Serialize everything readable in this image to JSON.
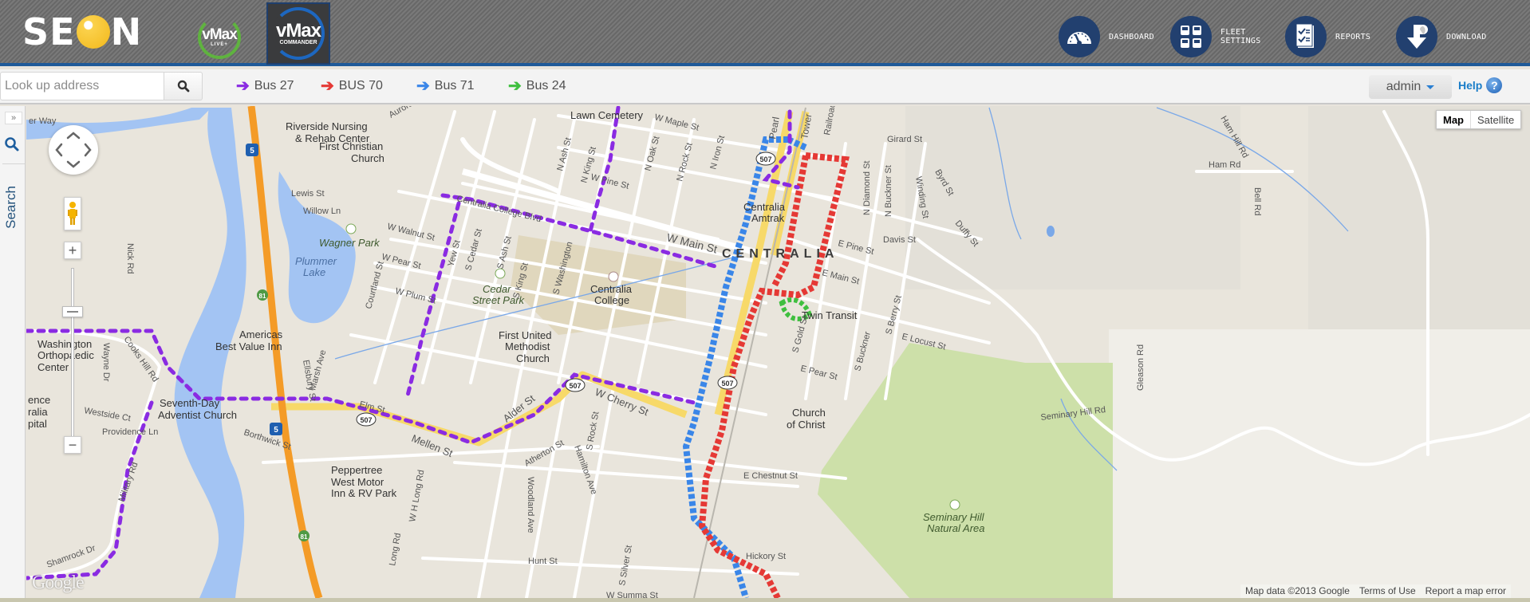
{
  "header": {
    "brand": "SEON",
    "apps": [
      {
        "name": "vMax",
        "sub": "LIVE+",
        "active": false
      },
      {
        "name": "vMax",
        "sub": "COMMANDER",
        "active": true
      }
    ],
    "nav": [
      {
        "label": "DASHBOARD",
        "icon": "speedometer-icon"
      },
      {
        "label": "FLEET\nSETTINGS",
        "icon": "fleet-buses-icon"
      },
      {
        "label": "REPORTS",
        "icon": "checklist-report-icon"
      },
      {
        "label": "DOWNLOAD",
        "icon": "download-arrow-icon"
      }
    ]
  },
  "toolbar": {
    "search_placeholder": "Look up address",
    "search_value": "",
    "buses": [
      {
        "label": "Bus 27",
        "color": "#8a2be2"
      },
      {
        "label": "BUS 70",
        "color": "#e53935"
      },
      {
        "label": "Bus 71",
        "color": "#3a86e8"
      },
      {
        "label": "Bus 24",
        "color": "#3fbf3f"
      }
    ],
    "user": "admin",
    "help": "Help",
    "help_icon": "?"
  },
  "sidepanel": {
    "expand": "»",
    "search_label": "Search"
  },
  "map": {
    "type_buttons": [
      {
        "label": "Map",
        "active": true
      },
      {
        "label": "Satellite",
        "active": false
      }
    ],
    "zoom_in": "+",
    "zoom_out": "−",
    "attribution": {
      "data": "Map data ©2013 Google",
      "terms": "Terms of Use",
      "report": "Report a map error"
    },
    "google_logo": "Google",
    "town_label": "CENTRALIA",
    "pois": [
      "Riverside Nursing",
      "& Rehab Center",
      "First Christian",
      "Church",
      "Wagner Park",
      "Plummer",
      "Lake",
      "Cedar",
      "Street Park",
      "Centralia",
      "College",
      "First United",
      "Methodist",
      "Church",
      "Americas",
      "Best Value Inn",
      "Washington",
      "Orthopaedic",
      "Center",
      "Seventh-Day",
      "Adventist Church",
      "Peppertree",
      "West Motor",
      "Inn & RV Park",
      "Centralia",
      "Amtrak",
      "Twin Transit",
      "Church",
      "of Christ",
      "Seminary Hill",
      "Natural Area",
      "Lawn Cemetery",
      "ence",
      "ralia",
      "pital"
    ],
    "streets": [
      "W Main St",
      "Centralia College Blvd",
      "W Walnut St",
      "W Pear St",
      "W Plum St",
      "Yew St",
      "S Cedar St",
      "S Ash St",
      "S King St",
      "S Washington",
      "Courtland St",
      "Lewis St",
      "Willow Ln",
      "W Pine St",
      "N Ash St",
      "N King St",
      "N Oak St",
      "N Rock St",
      "N Iron St",
      "W Maple St",
      "Girard St",
      "N Diamond St",
      "N Buckner St",
      "Winding St",
      "Davis St",
      "E Pine St",
      "E Main St",
      "E Locust St",
      "S Berry St",
      "S Gold St",
      "E Pear St",
      "S Buckner",
      "E Chestnut St",
      "Hickory St",
      "W Cherry St",
      "Alder St",
      "Mellen St",
      "Elm St",
      "Borthwick St",
      "Marsh Ave",
      "Ellsbury St",
      "Cooks Hill Rd",
      "Wayne Dr",
      "Westside Ct",
      "Providence Ln",
      "Military Rd",
      "Shamrock Dr",
      "Long Rd",
      "W H Long Rd",
      "Woodland Ave",
      "Hunt St",
      "S Silver St",
      "Hamilton Ave",
      "S Rock St",
      "Atherton St",
      "W Summa St",
      "Seminary Hill Rd",
      "Byrd St",
      "Duffy St",
      "Gleason Rd",
      "Ham Hill Rd",
      "Ham Rd",
      "Bell Rd",
      "Nick Rd",
      "er Way",
      "Aurora St",
      "Pearl",
      "Tower",
      "Railroad"
    ],
    "shields": [
      "5",
      "81",
      "507"
    ]
  }
}
